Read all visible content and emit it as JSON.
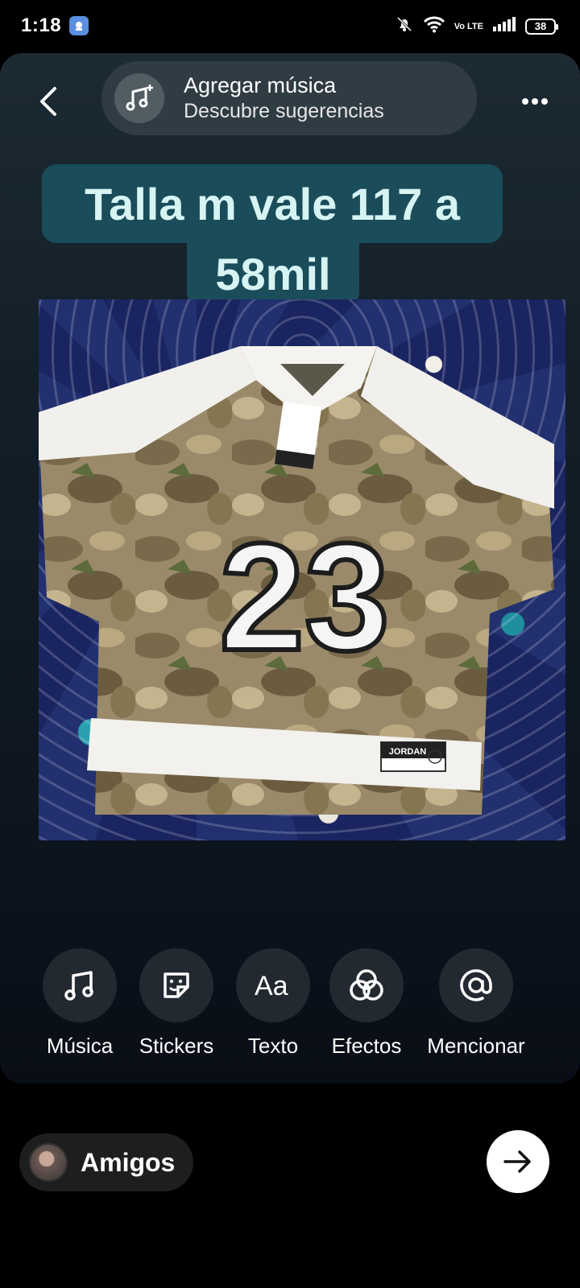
{
  "status_bar": {
    "time": "1:18",
    "network": "Vo LTE",
    "battery": "38"
  },
  "header": {
    "music_title": "Agregar música",
    "music_subtitle": "Descubre sugerencias"
  },
  "caption": {
    "line1": "Talla m vale 117 a",
    "line2": "58mil",
    "background_color": "#1a4c5a",
    "text_color": "#d7f4f4"
  },
  "photo": {
    "jersey_number": "23",
    "brand_label": "JORDAN"
  },
  "tools": [
    {
      "label": "Música",
      "icon": "music-note-icon"
    },
    {
      "label": "Stickers",
      "icon": "sticker-icon"
    },
    {
      "label": "Texto",
      "icon": "text-aa-icon"
    },
    {
      "label": "Efectos",
      "icon": "effects-icon"
    },
    {
      "label": "Mencionar",
      "icon": "at-mention-icon"
    }
  ],
  "bottom_bar": {
    "audience_label": "Amigos"
  }
}
